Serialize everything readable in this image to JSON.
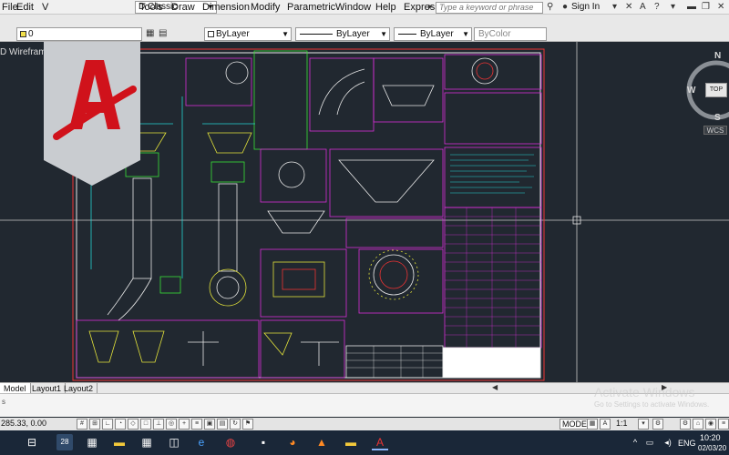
{
  "menubar": {
    "items": [
      "File",
      "Edit",
      "V",
      "Tools",
      "Draw",
      "Dimension",
      "Modify",
      "Parametric",
      "Window",
      "Help",
      "Express"
    ],
    "workspace": "D Classic",
    "search_placeholder": "Type a keyword or phrase",
    "signin": "Sign In"
  },
  "propbar": {
    "layer": "0",
    "color": "ByLayer",
    "linetype": "ByLayer",
    "lineweight": "ByLayer",
    "plotstyle": "ByColor"
  },
  "viewport": {
    "label": "D Wireframe]",
    "viewcube": {
      "n": "N",
      "s": "S",
      "w": "W",
      "top": "TOP",
      "wcs": "WCS"
    }
  },
  "tabs": [
    "Model",
    "Layout1",
    "Layout2"
  ],
  "status": {
    "coords": "285.33, 0.00",
    "model": "MODEL",
    "scale": "1:1",
    "lang": "ENG",
    "time": "10:20",
    "date": "02/03/20",
    "taskbar_badge": "28"
  },
  "watermark": {
    "title": "Activate Windows",
    "subtitle": "Go to Settings to activate Windows."
  },
  "colors": {
    "canvas": "#212830",
    "line_magenta": "#d62fd6",
    "line_cyan": "#25d3d3",
    "line_yellow": "#e3e33a",
    "line_green": "#38e038",
    "line_white": "#e8e8e8",
    "logo_red": "#d0121b"
  }
}
